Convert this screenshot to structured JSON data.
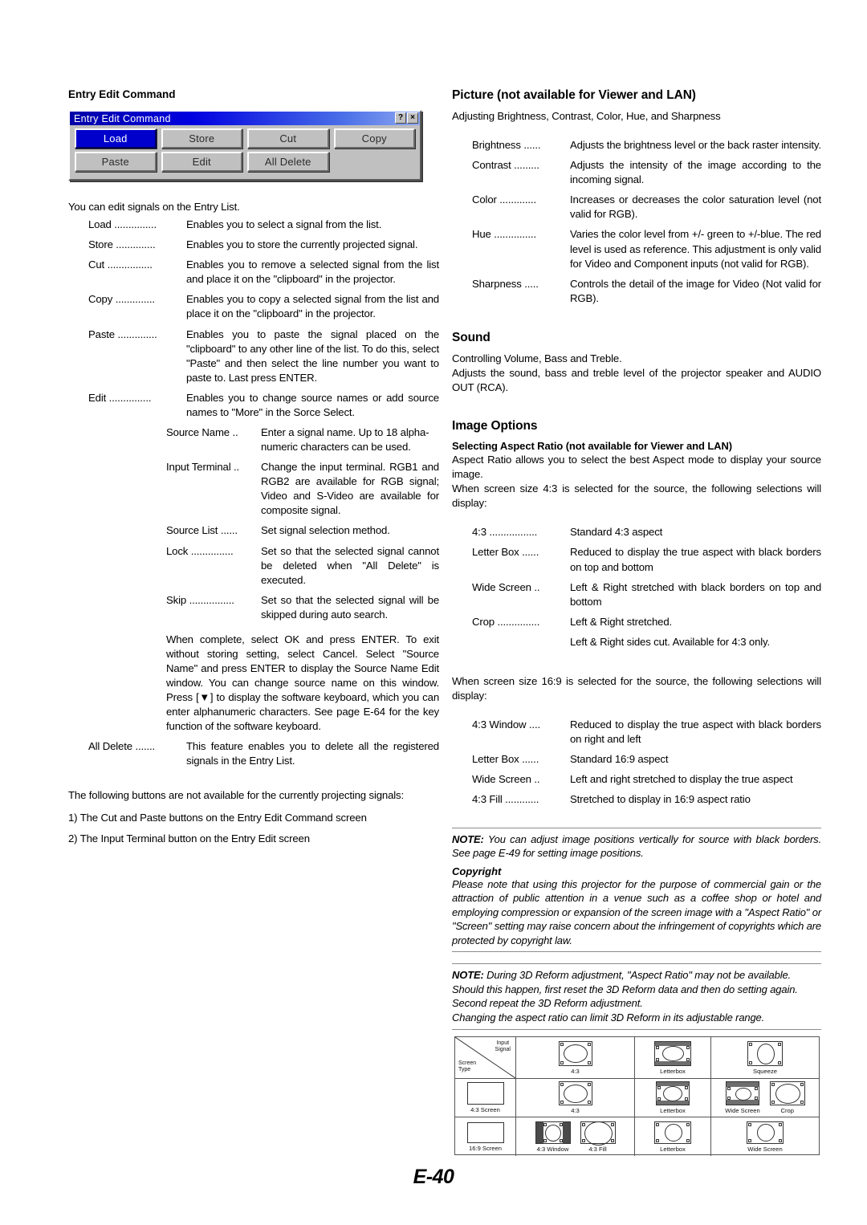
{
  "page": {
    "number": "E-40"
  },
  "left": {
    "heading": "Entry Edit Command",
    "dialog": {
      "title": "Entry Edit Command",
      "help_btn": "?",
      "close_btn": "×",
      "buttons": [
        "Load",
        "Store",
        "Cut",
        "Copy",
        "Paste",
        "Edit",
        "All Delete"
      ],
      "selected": "Load"
    },
    "intro": "You can edit signals on the Entry List.",
    "entries": [
      {
        "term": "Load ...............",
        "desc": "Enables you to select a signal from the list."
      },
      {
        "term": "Store ..............",
        "desc": "Enables you to store the currently projected signal."
      },
      {
        "term": "Cut ................",
        "desc": "Enables you to remove a selected signal from the list and place it on the \"clipboard\" in the projector."
      },
      {
        "term": "Copy ..............",
        "desc": "Enables you to copy a selected signal from the list and place it on the \"clipboard\" in the projector."
      },
      {
        "term": "Paste ..............",
        "desc": "Enables you to paste the signal placed on the \"clipboard\" to any other line of the list. To do this, select \"Paste\" and then select the line number you want to paste to. Last press ENTER."
      },
      {
        "term": "Edit ...............",
        "desc": "Enables you to change source names or add source names to \"More\" in the Sorce Select."
      }
    ],
    "sub_entries": [
      {
        "term": "Source Name ..",
        "desc": "Enter a signal name. Up to 18 alpha-numeric characters can be used."
      },
      {
        "term": "Input Terminal ..",
        "desc": "Change the input terminal. RGB1 and RGB2 are available for RGB signal; Video and S-Video are available for composite signal."
      },
      {
        "term": "Source List ......",
        "desc": "Set signal selection method."
      },
      {
        "term": "Lock ...............",
        "desc": "Set so that the selected signal cannot be deleted when \"All Delete\" is executed."
      },
      {
        "term": "Skip ................",
        "desc": "Set so that the selected signal will be skipped during auto search."
      }
    ],
    "complete_note": "When complete, select OK and press ENTER. To exit without storing setting, select Cancel. Select \"Source Name\" and press ENTER to display the Source Name Edit window. You can change source name on this window. Press [▼] to display the software keyboard, which you can enter alphanumeric characters. See page E-64 for the key function of the software keyboard.",
    "all_delete": {
      "term": "All Delete .......",
      "desc": "This feature enables you to delete all the registered signals in the Entry List."
    },
    "footer_intro": "The following buttons are not available for the currently projecting signals:",
    "footer_items": [
      "1) The Cut and Paste buttons on the Entry Edit Command screen",
      "2) The Input Terminal button on the Entry Edit screen"
    ]
  },
  "right": {
    "picture": {
      "heading": "Picture (not available for Viewer and LAN)",
      "subtitle": "Adjusting Brightness, Contrast, Color, Hue, and Sharpness",
      "items": [
        {
          "term": "Brightness ......",
          "desc": "Adjusts the brightness level or the back raster intensity."
        },
        {
          "term": "Contrast .........",
          "desc": "Adjusts the intensity of the image according to the incoming signal."
        },
        {
          "term": "Color .............",
          "desc": "Increases or decreases the color saturation level (not valid for RGB)."
        },
        {
          "term": "Hue ...............",
          "desc": "Varies the color level from +/- green to +/-blue. The red level is used as reference. This adjustment is only valid for Video and Component inputs (not valid for RGB)."
        },
        {
          "term": "Sharpness .....",
          "desc": "Controls the detail of the image for Video (Not valid for RGB)."
        }
      ]
    },
    "sound": {
      "heading": "Sound",
      "line1": "Controlling Volume, Bass and Treble.",
      "line2": "Adjusts the sound, bass and treble level of the projector speaker and AUDIO OUT (RCA)."
    },
    "image_options": {
      "heading": "Image Options",
      "sub_heading": "Selecting Aspect Ratio (not available for Viewer and LAN)",
      "para1": "Aspect Ratio allows you to select the best Aspect mode to display your source image.",
      "para2": "When screen size 4:3 is selected for the source, the following selections will display:",
      "items_43": [
        {
          "term": "4:3 .................",
          "desc": "Standard 4:3 aspect"
        },
        {
          "term": "Letter Box ......",
          "desc": "Reduced to display the true aspect with black borders on top and bottom"
        },
        {
          "term": "Wide Screen ..",
          "desc": "Left & Right stretched with black borders on top and bottom"
        },
        {
          "term": "Crop ...............",
          "desc": "Left & Right stretched."
        },
        {
          "term": "",
          "desc": "Left & Right sides cut. Available for 4:3 only."
        }
      ],
      "para3": "When screen size 16:9 is selected for the source, the following selections will display:",
      "items_169": [
        {
          "term": "4:3 Window ....",
          "desc": "Reduced to display the true aspect with black borders on right and left"
        },
        {
          "term": "Letter Box ......",
          "desc": "Standard 16:9 aspect"
        },
        {
          "term": "Wide Screen ..",
          "desc": "Left and right stretched to display the true aspect"
        },
        {
          "term": "4:3 Fill ............",
          "desc": "Stretched to display in 16:9 aspect ratio"
        }
      ]
    },
    "note1": {
      "lead": "NOTE:",
      "text": " You can adjust image positions vertically for source with black borders. See page E-49 for setting image positions.",
      "copyright_heading": "Copyright",
      "copyright_text": "Please note that using this projector for the purpose of commercial gain or the attraction of public attention in a venue such as a coffee shop or hotel and employing compression or expansion of the screen image with a \"Aspect Ratio\" or \"Screen\" setting may raise concern about the infringement of copyrights which are protected by copyright law."
    },
    "note2": {
      "lead": "NOTE:",
      "line1": " During 3D Reform adjustment, \"Aspect Ratio\" may not be available.",
      "line2": "Should this happen, first reset the 3D Reform data and then do setting again.",
      "line3": "Second repeat the 3D Reform adjustment.",
      "line4": "Changing the aspect ratio can limit 3D Reform in its adjustable range."
    },
    "aspect_table": {
      "corner_input_label": "Input\nSignal",
      "corner_screen_label": "Screen\nType",
      "rows": [
        {
          "label": "",
          "cells": [
            [
              "4:3"
            ],
            [
              "Letterbox"
            ],
            [
              "Squeeze"
            ]
          ]
        },
        {
          "label": "4:3 Screen",
          "cells": [
            [
              "4:3"
            ],
            [
              "Letterbox"
            ],
            [
              "Wide Screen",
              "Crop"
            ]
          ]
        },
        {
          "label": "16:9 Screen",
          "cells": [
            [
              "4:3 Window",
              "4:3 Fill"
            ],
            [
              "Letterbox"
            ],
            [
              "Wide Screen"
            ]
          ]
        }
      ]
    }
  }
}
